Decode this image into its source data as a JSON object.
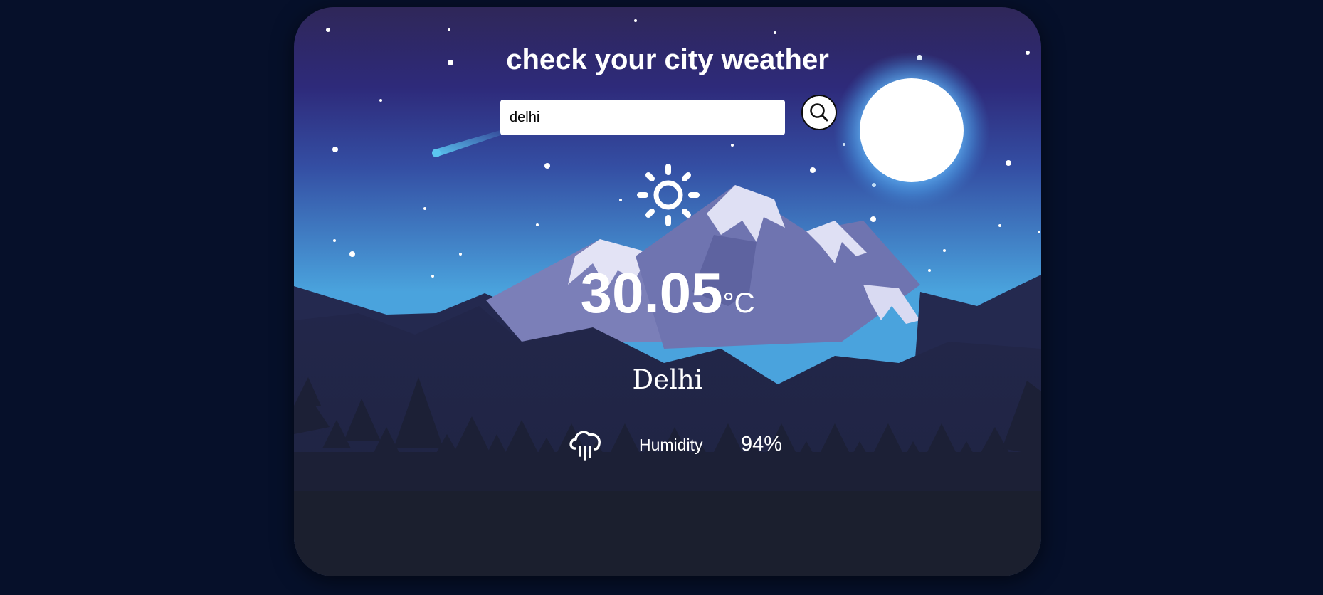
{
  "app": {
    "title": "check your city weather"
  },
  "search": {
    "value": "delhi",
    "button_icon": "search-icon"
  },
  "weather": {
    "icon": "sun-icon",
    "temperature": "30.05",
    "unit": "°C",
    "city": "Delhi"
  },
  "details": {
    "humidity_icon": "rain-cloud-icon",
    "humidity_label": "Humidity",
    "humidity_value": "94%"
  },
  "colors": {
    "page_background": "#06102a",
    "sky_top": "#2f2759",
    "sky_mid": "#2e2a7a",
    "sky_horizon": "#4aa3dd",
    "mountain_shadow": "#22264a",
    "forest": "#1b1f2e",
    "text": "#ffffff"
  }
}
